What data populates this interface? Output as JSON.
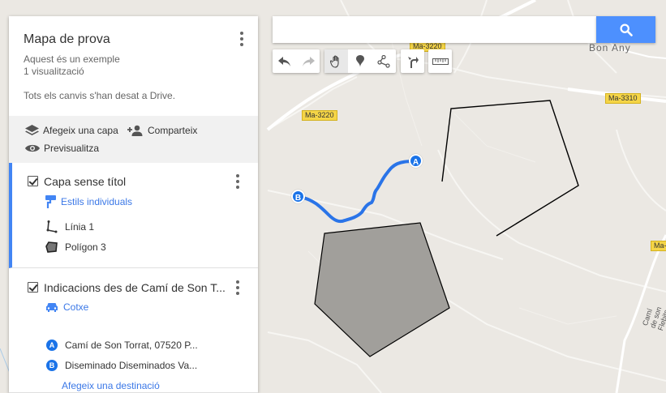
{
  "map": {
    "road_labels": [
      "Ma-3220",
      "Ma-3220",
      "Ma-3310",
      "Ma-"
    ],
    "place_label": "Bon Any",
    "street_label": "Camí de son Flebits",
    "marker_a": "A",
    "marker_b": "B",
    "colors": {
      "route": "#2a74e8",
      "polygon_fill": "#a19f9b",
      "land": "#ebe8e3"
    }
  },
  "panel": {
    "title": "Mapa de prova",
    "description": "Aquest és un exemple",
    "views": "1 visualització",
    "save_status": "Tots els canvis s'han desat a Drive.",
    "add_layer": "Afegeix una capa",
    "share": "Comparteix",
    "preview": "Previsualitza",
    "layers": [
      {
        "title": "Capa sense títol",
        "style": "Estils individuals",
        "items": [
          {
            "icon": "line-icon",
            "label": "Línia 1"
          },
          {
            "icon": "polygon-icon",
            "label": "Polígon 3"
          }
        ]
      },
      {
        "title": "Indicacions des de Camí de Son T...",
        "mode": "Cotxe",
        "stops": [
          {
            "marker": "A",
            "label": "Camí de Son Torrat, 07520 P..."
          },
          {
            "marker": "B",
            "label": "Diseminado Diseminados Va..."
          }
        ],
        "add_destination": "Afegeix una destinació"
      }
    ]
  },
  "search": {
    "value": "",
    "placeholder": ""
  },
  "tools": [
    "undo-icon",
    "redo-icon",
    "hand-icon",
    "marker-icon",
    "draw-line-icon",
    "directions-icon",
    "ruler-icon"
  ]
}
